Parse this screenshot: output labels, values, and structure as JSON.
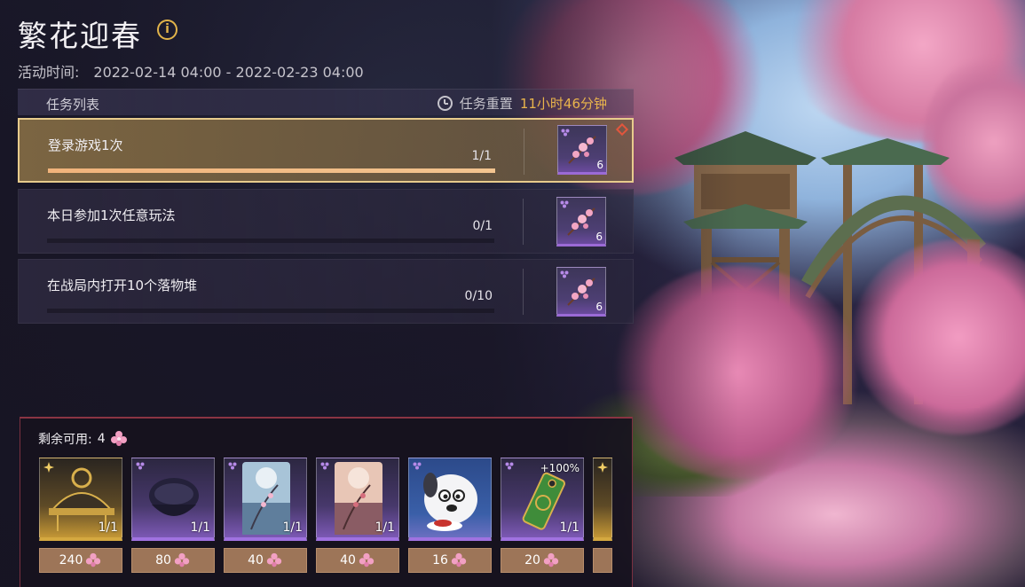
{
  "event": {
    "title": "繁花迎春",
    "period_label": "活动时间:",
    "period_value": "2022-02-14 04:00 - 2022-02-23 04:00"
  },
  "task_list": {
    "header": "任务列表",
    "reset_label": "任务重置",
    "reset_time": "11小时46分钟",
    "tasks": [
      {
        "name": "登录游戏1次",
        "count": "1/1",
        "progress": 1.0,
        "reward_qty": "6",
        "active": true
      },
      {
        "name": "本日参加1次任意玩法",
        "count": "0/1",
        "progress": 0.0,
        "reward_qty": "6",
        "active": false
      },
      {
        "name": "在战局内打开10个落物堆",
        "count": "0/10",
        "progress": 0.0,
        "reward_qty": "6",
        "active": false
      }
    ]
  },
  "shop": {
    "remaining_label": "剩余可用:",
    "remaining_value": "4",
    "items": [
      {
        "icon": "golden-hat-icon",
        "rarity": "gold",
        "qty": "1/1",
        "price": "240"
      },
      {
        "icon": "dark-helmet-icon",
        "rarity": "purple",
        "qty": "1/1",
        "price": "80"
      },
      {
        "icon": "blossom-card-blue-icon",
        "rarity": "purple",
        "qty": "1/1",
        "price": "40"
      },
      {
        "icon": "blossom-card-peach-icon",
        "rarity": "purple",
        "qty": "1/1",
        "price": "40"
      },
      {
        "icon": "dog-emote-icon",
        "rarity": "purple",
        "qty": "",
        "price": "16"
      },
      {
        "icon": "green-tag-icon",
        "rarity": "purple",
        "bonus": "+100%",
        "qty": "1/1",
        "price": "20"
      }
    ]
  },
  "colors": {
    "accent_gold": "#e9b44c",
    "progress_fill": "#f1b37b",
    "purple_rarity": "#a072e0",
    "gold_rarity": "#d4a840",
    "price_bg": "#9d7558"
  }
}
